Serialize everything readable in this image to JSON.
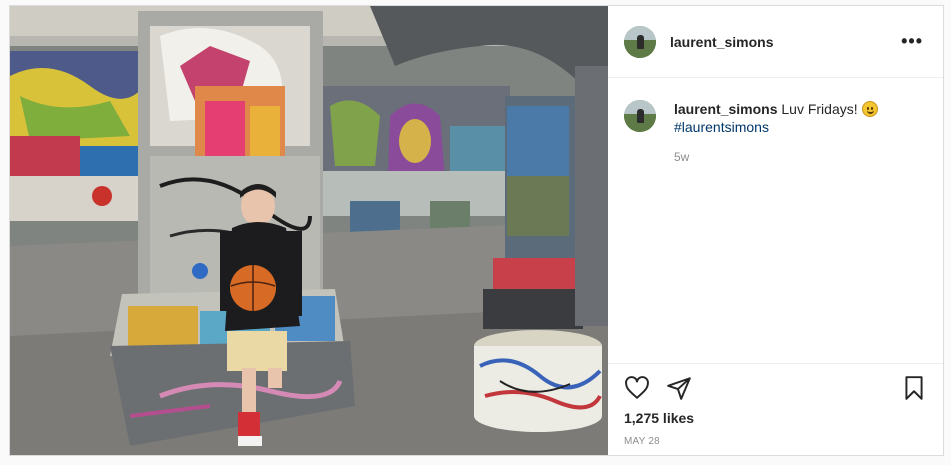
{
  "post": {
    "username": "laurent_simons",
    "more_label": "•••",
    "caption": {
      "username": "laurent_simons",
      "text": "Luv Fridays!",
      "emoji": "smiling-face",
      "hashtag": "#laurentsimons"
    },
    "age": "5w",
    "likes": "1,275 likes",
    "date": "MAY 28"
  },
  "colors": {
    "link": "#00376b",
    "muted": "#8e8e8e",
    "text": "#262626",
    "border": "#dbdbdb"
  },
  "icons": [
    "heart-icon",
    "share-icon",
    "bookmark-icon",
    "more-icon"
  ]
}
